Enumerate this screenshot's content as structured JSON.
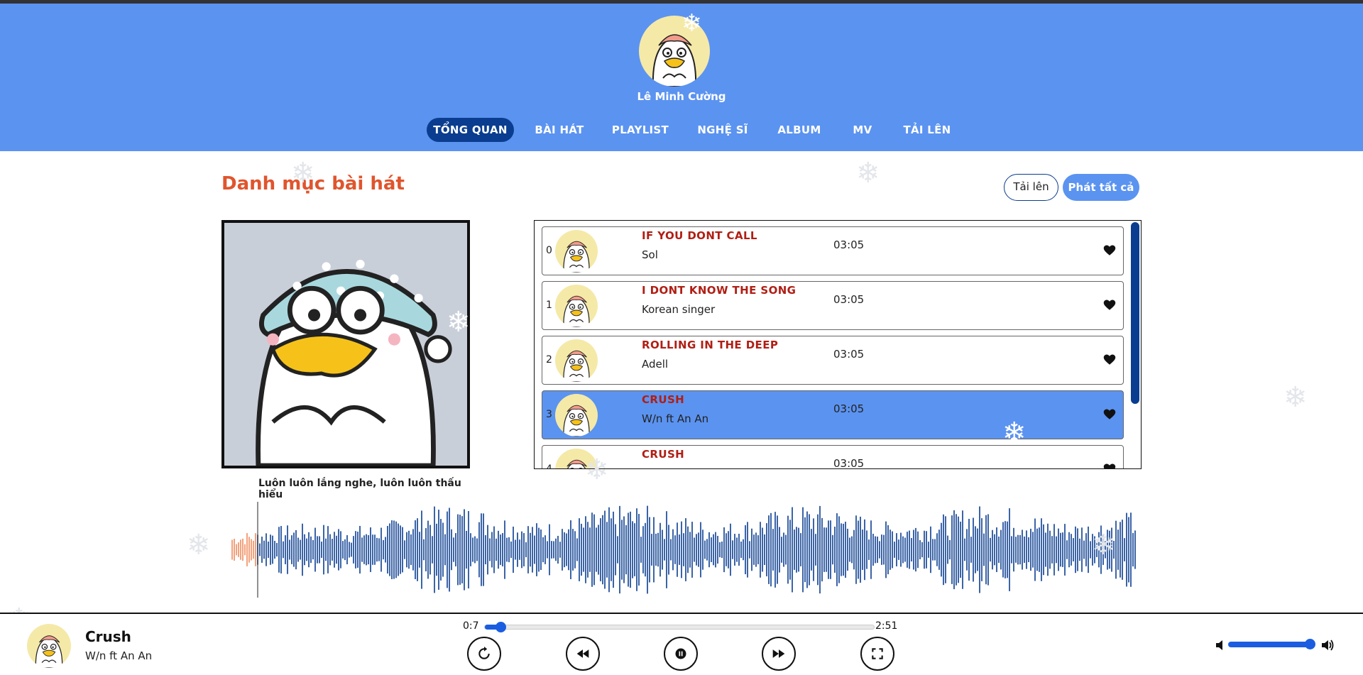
{
  "header": {
    "username": "Lê Minh Cường",
    "nav": [
      {
        "label": "TỔNG QUAN",
        "active": true
      },
      {
        "label": "BÀI HÁT",
        "active": false
      },
      {
        "label": "PLAYLIST",
        "active": false
      },
      {
        "label": "NGHỆ SĨ",
        "active": false
      },
      {
        "label": "ALBUM",
        "active": false
      },
      {
        "label": "MV",
        "active": false
      },
      {
        "label": "TẢI LÊN",
        "active": false
      }
    ]
  },
  "main": {
    "section_title": "Danh mục bài hát",
    "upload_label": "Tải lên",
    "play_all_label": "Phát tất cả",
    "cover_caption": "Luôn luôn lắng nghe, luôn luôn thấu hiểu"
  },
  "songs": [
    {
      "index": "0",
      "title": "IF YOU DONT CALL",
      "artist": "Sol",
      "duration": "03:05",
      "active": false
    },
    {
      "index": "1",
      "title": "I DONT KNOW THE SONG",
      "artist": "Korean singer",
      "duration": "03:05",
      "active": false
    },
    {
      "index": "2",
      "title": "ROLLING IN THE DEEP",
      "artist": "Adell",
      "duration": "03:05",
      "active": false
    },
    {
      "index": "3",
      "title": "CRUSH",
      "artist": "W/n ft An An",
      "duration": "03:05",
      "active": true
    },
    {
      "index": "4",
      "title": "CRUSH",
      "artist": "",
      "duration": "03:05",
      "active": false
    }
  ],
  "player": {
    "title": "Crush",
    "artist": "W/n ft An An",
    "current_time": "0:7",
    "duration": "2:51",
    "progress_fraction": 0.04,
    "volume_fraction": 0.95
  },
  "colors": {
    "header_bg": "#5b93f0",
    "nav_active_bg": "#0a3d8f",
    "accent_title": "#e0552d",
    "song_title": "#b01e14",
    "waveform": "#0a3d8f",
    "waveform_played": "#f08a5d",
    "slider": "#1a5de0"
  },
  "icons": [
    "duck-avatar-icon",
    "heart-icon",
    "replay-icon",
    "rewind-icon",
    "pause-icon",
    "forward-icon",
    "fullscreen-icon",
    "volume-low-icon",
    "volume-high-icon",
    "snowflake-icon"
  ]
}
